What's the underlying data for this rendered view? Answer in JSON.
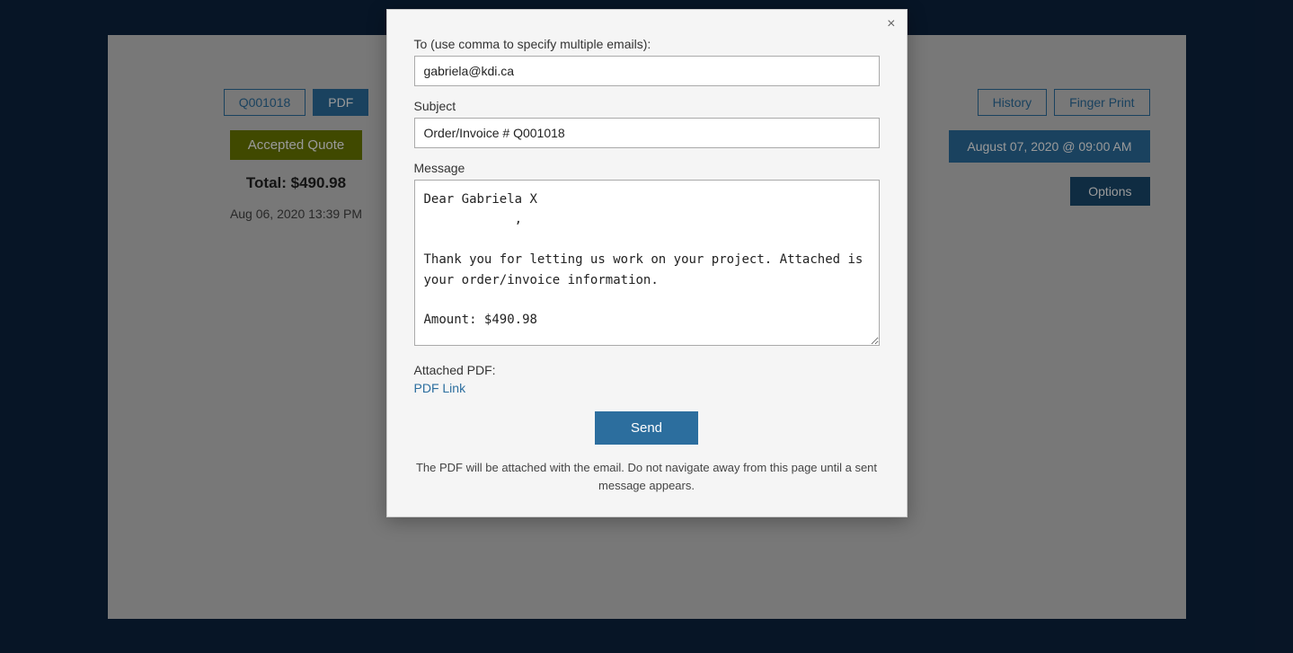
{
  "background": {
    "order_id": "Q001018",
    "pdf_button": "PDF",
    "status": "Accepted Quote",
    "total": "Total: $490.98",
    "date": "Aug 06, 2020  13:39 PM",
    "history_button": "History",
    "fingerprint_button": "Finger Print",
    "datetime_button": "August 07, 2020 @ 09:00 AM",
    "options_button": "Options"
  },
  "modal": {
    "close_button": "×",
    "to_label": "To (use comma to specify multiple emails):",
    "to_value": "gabriela@kdi.ca",
    "subject_label": "Subject",
    "subject_value": "Order/Invoice # Q001018",
    "message_label": "Message",
    "message_value": "Dear Gabriela X\n\t\t\t\t\t\t,\n\nThank you for letting us work on your project. Attached is your order/invoice information.\n\nAmount: $490.98\n\nPlease contact us if you have any question or concerns. We look forward to continue working with you!",
    "attached_label": "Attached PDF:",
    "pdf_link": "PDF Link",
    "send_button": "Send",
    "disclaimer": "The PDF will be attached with the email. Do not navigate away from this page until a sent message appears."
  }
}
